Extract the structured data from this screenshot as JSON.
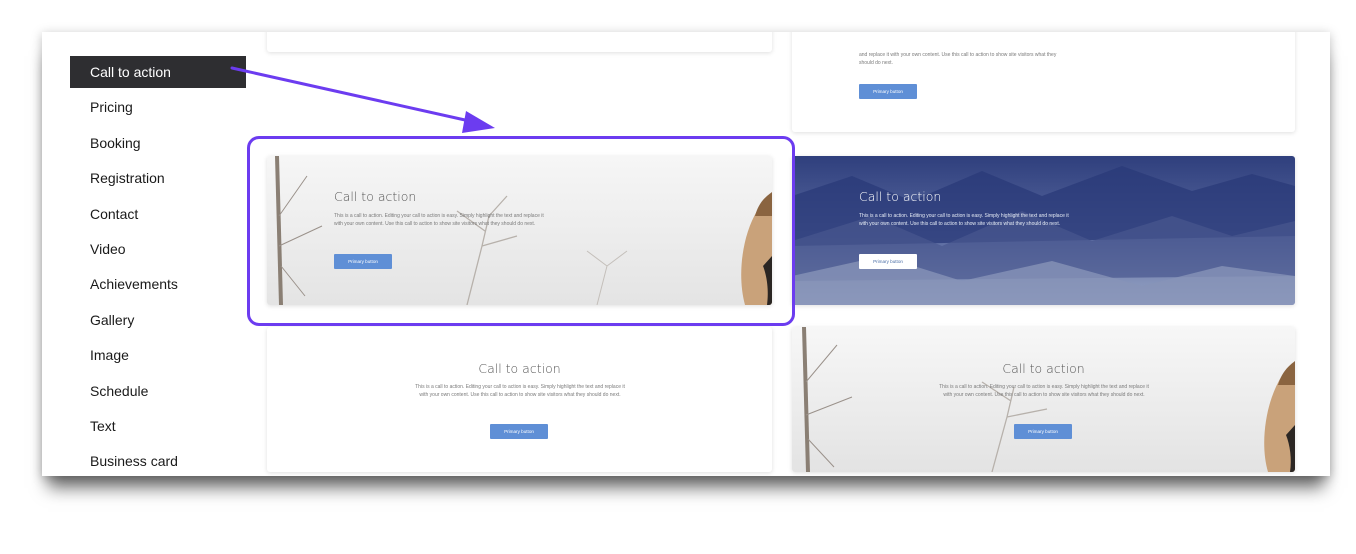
{
  "sidebar": {
    "items": [
      {
        "label": "Call to action",
        "active": true
      },
      {
        "label": "Pricing"
      },
      {
        "label": "Booking"
      },
      {
        "label": "Registration"
      },
      {
        "label": "Contact"
      },
      {
        "label": "Video"
      },
      {
        "label": "Achievements"
      },
      {
        "label": "Gallery"
      },
      {
        "label": "Image"
      },
      {
        "label": "Schedule"
      },
      {
        "label": "Text"
      },
      {
        "label": "Business card"
      }
    ]
  },
  "cards": {
    "top_right": {
      "text": "and replace it with your own content. Use this call to action to show site visitors what they should do next.",
      "button": "Primary button"
    },
    "highlighted": {
      "title": "Call to action",
      "text": "This is a call to action. Editing your call to action is easy. Simply highlight the text and replace it with your own content. Use this call to action to show site visitors what they should do next.",
      "button": "Primary button"
    },
    "mountains": {
      "title": "Call to action",
      "text": "This is a call to action. Editing your call to action is easy. Simply highlight the text and replace it with your own content. Use this call to action to show site visitors what they should do next.",
      "button": "Primary button"
    },
    "centered_plain": {
      "title": "Call to action",
      "text": "This is a call to action. Editing your call to action is easy. Simply highlight the text and replace it with your own content. Use this call to action to show site visitors what they should do next.",
      "button": "Primary button"
    },
    "centered_image": {
      "title": "Call to action",
      "text": "This is a call to action. Editing your call to action is easy. Simply highlight the text and replace it with your own content. Use this call to action to show site visitors what they should do next.",
      "button": "Primary button"
    }
  },
  "colors": {
    "active_bg": "#2e2e31",
    "annotation": "#6c3cf0",
    "button": "#5f8fd6",
    "mountain_sky": "#3a4d8c"
  }
}
